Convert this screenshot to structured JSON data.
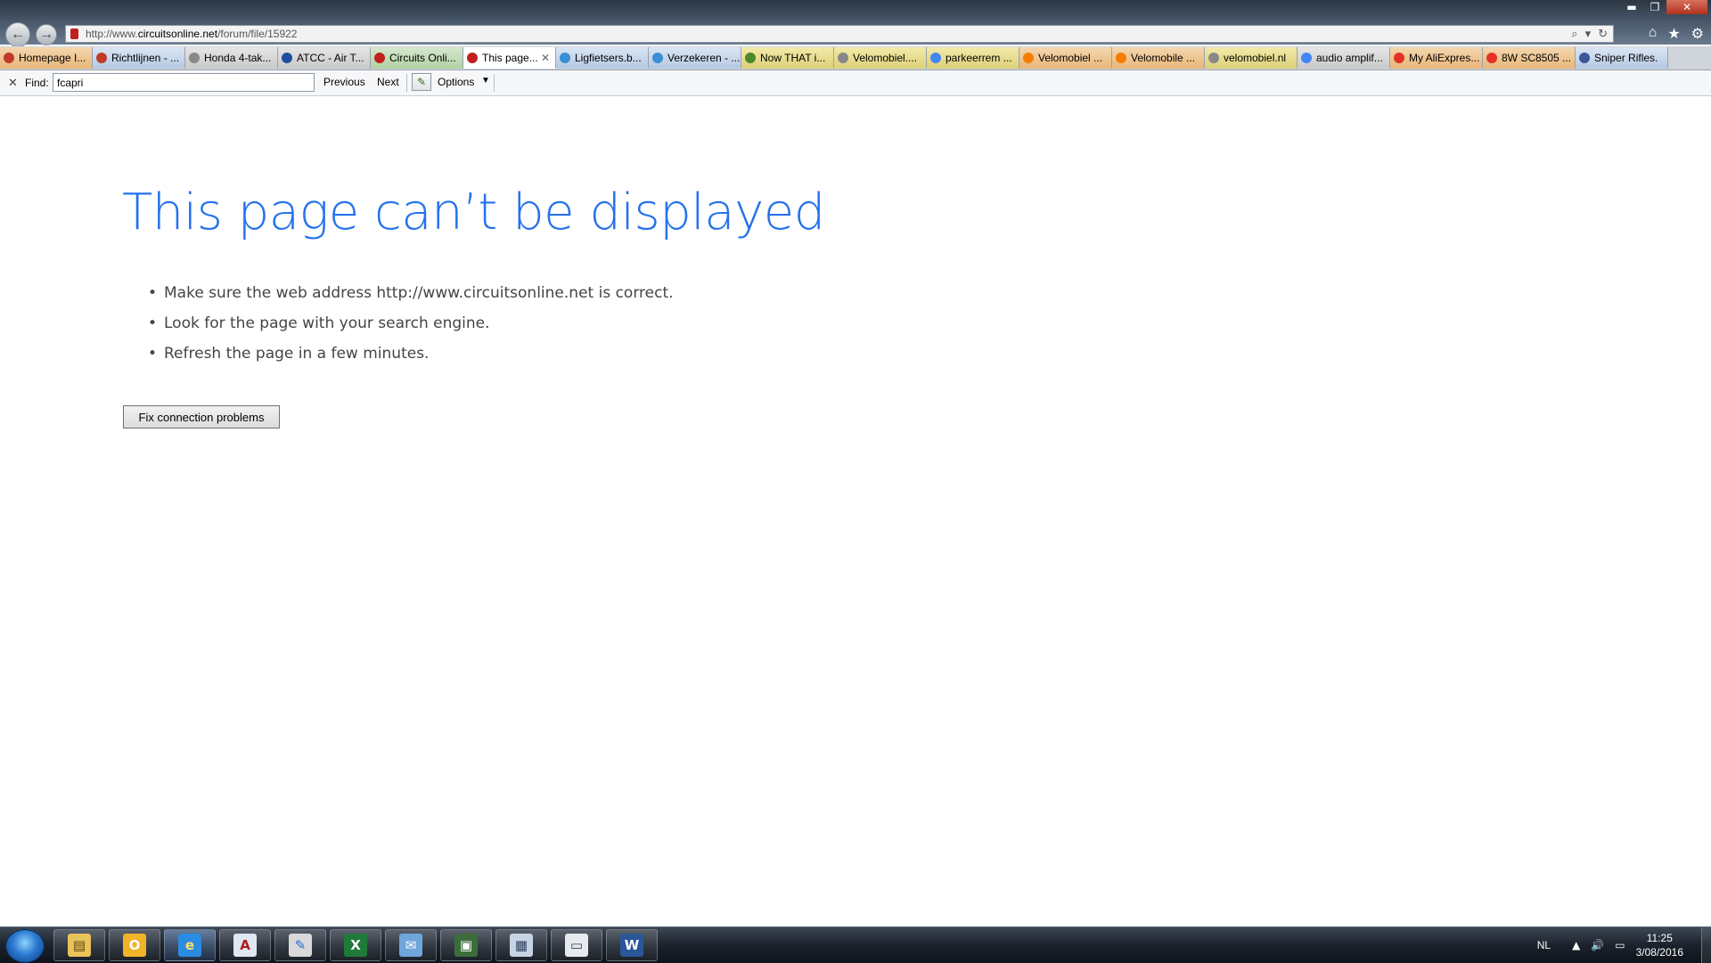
{
  "window": {
    "minimize": "▬",
    "maximize": "❐",
    "close": "✕"
  },
  "nav": {
    "back": "←",
    "forward": "→"
  },
  "address": {
    "prefix": "http://www.",
    "host": "circuitsonline.net",
    "path": "/forum/file/15922",
    "search_glyph": "⌕",
    "dropdown_glyph": "▾",
    "refresh_glyph": "↻"
  },
  "toolbar": {
    "home_glyph": "⌂",
    "favorites_glyph": "★",
    "tools_glyph": "⚙"
  },
  "tabs": [
    {
      "label": "Homepage I...",
      "color": "#c0392b",
      "style": "c-orange"
    },
    {
      "label": "Richtlijnen - ...",
      "color": "#c0392b",
      "style": "c-blue"
    },
    {
      "label": "Honda 4-tak...",
      "color": "#888888",
      "style": "c-grey"
    },
    {
      "label": "ATCC - Air T...",
      "color": "#1f4fa0",
      "style": "c-grey"
    },
    {
      "label": "Circuits Onli...",
      "color": "#c0201e",
      "style": "c-green"
    },
    {
      "label": "This page...",
      "color": "#c0201e",
      "style": "active",
      "close": "✕"
    },
    {
      "label": "Ligfietsers.b...",
      "color": "#3a8fd6",
      "style": "c-blue"
    },
    {
      "label": "Verzekeren - ...",
      "color": "#3a8fd6",
      "style": "c-blue"
    },
    {
      "label": "Now THAT i...",
      "color": "#4c8a2c",
      "style": "c-yellow"
    },
    {
      "label": "Velomobiel....",
      "color": "#888888",
      "style": "c-yellow"
    },
    {
      "label": "parkeerrem ...",
      "color": "#4285f4",
      "style": "c-yellow"
    },
    {
      "label": "Velomobiel ...",
      "color": "#f57d00",
      "style": "c-orange"
    },
    {
      "label": "Velomobile ...",
      "color": "#f57d00",
      "style": "c-orange"
    },
    {
      "label": "velomobiel.nl",
      "color": "#888888",
      "style": "c-yellow"
    },
    {
      "label": "audio amplif...",
      "color": "#4285f4",
      "style": "c-grey"
    },
    {
      "label": "My AliExpres...",
      "color": "#e43225",
      "style": "c-orange"
    },
    {
      "label": "8W SC8505 ...",
      "color": "#e43225",
      "style": "c-orange"
    },
    {
      "label": "Sniper Rifles.",
      "color": "#3b5998",
      "style": "c-blue"
    }
  ],
  "findbar": {
    "close": "✕",
    "label": "Find:",
    "value": "fcapri",
    "previous": "Previous",
    "next": "Next",
    "options": "Options",
    "options_caret": "▼",
    "pencil_glyph": "✎"
  },
  "page": {
    "title": "This page can’t be displayed",
    "bullets": [
      "Make sure the web address http://www.circuitsonline.net is correct.",
      "Look for the page with your search engine.",
      "Refresh the page in a few minutes."
    ],
    "fix_button": "Fix connection problems"
  },
  "taskbar": {
    "items": [
      {
        "name": "explorer",
        "glyph": "▤",
        "bg": "#e8c35a",
        "fg": "#5a4410"
      },
      {
        "name": "outlook",
        "glyph": "O",
        "bg": "#f0b429",
        "fg": "#ffffff"
      },
      {
        "name": "internet-explorer",
        "glyph": "e",
        "bg": "#2b8be0",
        "fg": "#ffe066",
        "active": true
      },
      {
        "name": "acrobat",
        "glyph": "A",
        "bg": "#dfe7f3",
        "fg": "#b01b1b"
      },
      {
        "name": "paint",
        "glyph": "✎",
        "bg": "#d9d9d9",
        "fg": "#2a6ad0"
      },
      {
        "name": "excel",
        "glyph": "X",
        "bg": "#1f7a3a",
        "fg": "#ffffff"
      },
      {
        "name": "mail",
        "glyph": "✉",
        "bg": "#6fa6dc",
        "fg": "#ffffff"
      },
      {
        "name": "terminal",
        "glyph": "▣",
        "bg": "#3c6e3c",
        "fg": "#ffffff"
      },
      {
        "name": "calculator",
        "glyph": "▦",
        "bg": "#c8d4e4",
        "fg": "#2d3f5a"
      },
      {
        "name": "window",
        "glyph": "▭",
        "bg": "#e6e9ee",
        "fg": "#2d3f5a"
      },
      {
        "name": "word",
        "glyph": "W",
        "bg": "#2b5797",
        "fg": "#ffffff"
      }
    ],
    "lang": "NL",
    "tray_up": "▲",
    "volume": "🔊",
    "network": "▭",
    "time": "11:25",
    "date": "3/08/2016"
  }
}
